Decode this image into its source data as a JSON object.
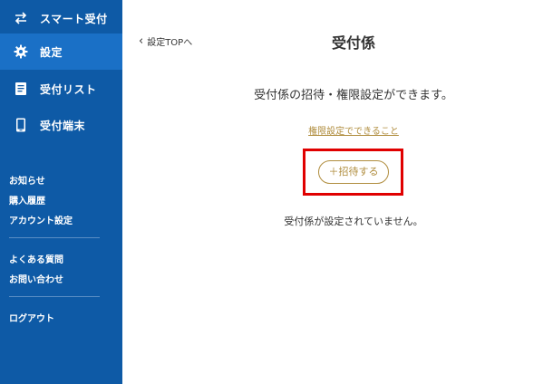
{
  "sidebar": {
    "nav": [
      {
        "label": "スマート受付",
        "icon": "swap-arrows-icon",
        "active": false
      },
      {
        "label": "設定",
        "icon": "gear-icon",
        "active": true
      },
      {
        "label": "受付リスト",
        "icon": "document-list-icon",
        "active": false
      },
      {
        "label": "受付端末",
        "icon": "tablet-icon",
        "active": false
      }
    ],
    "links_group1": [
      "お知らせ",
      "購入履歴",
      "アカウント設定"
    ],
    "links_group2": [
      "よくある質問",
      "お問い合わせ"
    ],
    "logout": "ログアウト"
  },
  "main": {
    "back_link": "設定TOPへ",
    "title": "受付係",
    "description": "受付係の招待・権限設定ができます。",
    "permission_link": "権限設定でできること",
    "invite_button": "＋招待する",
    "empty_message": "受付係が設定されていません。"
  },
  "colors": {
    "sidebar_bg": "#0e5aa6",
    "sidebar_active": "#1a70c6",
    "accent_gold": "#b08d3e",
    "highlight_red": "#e00000"
  }
}
